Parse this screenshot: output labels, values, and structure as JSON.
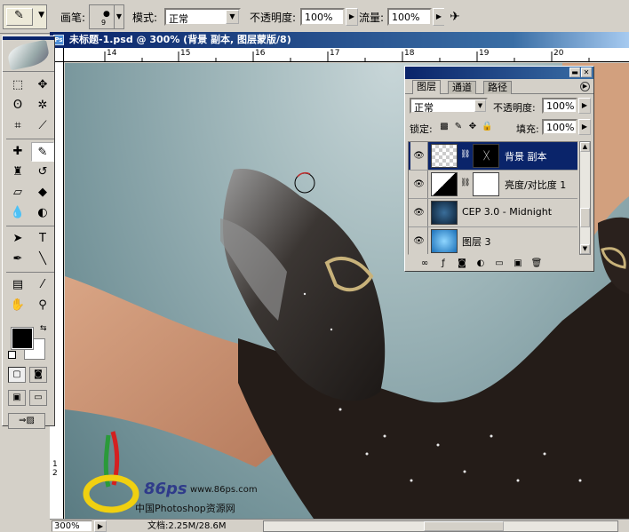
{
  "options_bar": {
    "brush_label": "画笔:",
    "brush_size": "9",
    "mode_label": "模式:",
    "mode_value": "正常",
    "opacity_label": "不透明度:",
    "opacity_value": "100%",
    "flow_label": "流量:",
    "flow_value": "100%"
  },
  "document": {
    "title": "未标题-1.psd @ 300% (背景 副本, 图层蒙版/8)",
    "hruler_ticks": [
      "14",
      "15",
      "16",
      "17",
      "18",
      "19",
      "20"
    ],
    "vruler_ticks": [
      "1",
      "2"
    ],
    "status_zoom": "300%",
    "status_doc": "文档:2.25M/28.6M"
  },
  "layers_panel": {
    "tabs": [
      "图层",
      "通道",
      "路径"
    ],
    "blend_mode": "正常",
    "opacity_label": "不透明度:",
    "opacity_value": "100%",
    "lock_label": "锁定:",
    "fill_label": "填充:",
    "fill_value": "100%",
    "layers": [
      {
        "name": "背景 副本",
        "selected": true
      },
      {
        "name": "亮度/对比度 1",
        "selected": false
      },
      {
        "name": "CEP 3.0 - Midnight",
        "selected": false
      },
      {
        "name": "图层 3",
        "selected": false
      }
    ]
  },
  "watermark": {
    "brand": "86ps",
    "site": "www.86ps.com",
    "cn": "中国Photoshop资源网"
  },
  "colors": {
    "title_bar": "#0a246a",
    "foreground": "#000000",
    "background": "#ffffff"
  }
}
